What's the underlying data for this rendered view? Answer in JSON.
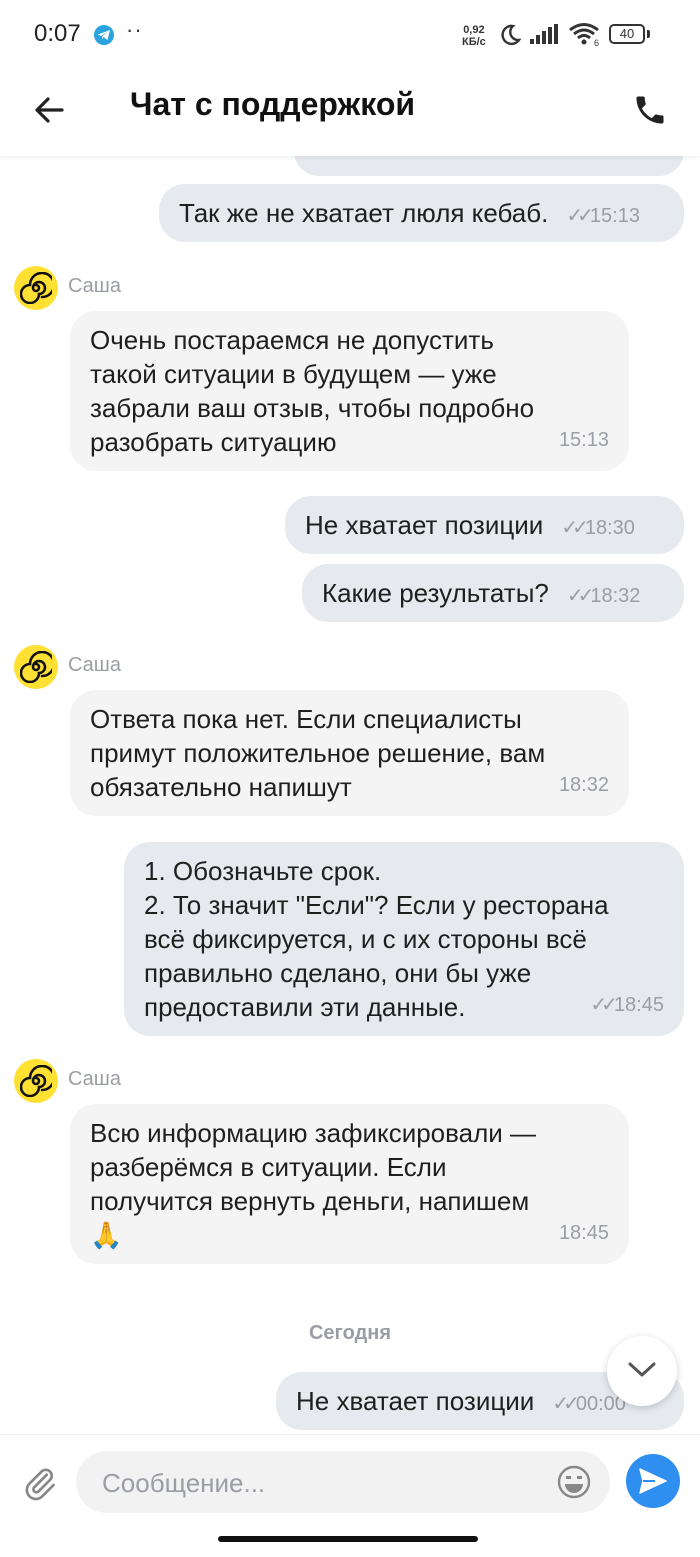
{
  "status": {
    "time": "0:07",
    "net_speed_value": "0,92",
    "net_speed_unit": "КБ/с",
    "battery": "40",
    "icons": [
      "telegram-icon",
      "moon-icon",
      "signal-icon",
      "wifi-icon",
      "battery-icon"
    ]
  },
  "header": {
    "title": "Чат с поддержкой",
    "back_icon": "arrow-left-icon",
    "call_icon": "phone-icon"
  },
  "messages": [
    {
      "id": 1,
      "direction": "out",
      "lines": [
        "Так же не хватает люля кебаб."
      ],
      "time": "15:13",
      "status": "read"
    },
    {
      "id": 2,
      "direction": "in",
      "sender": "Саша",
      "lines": [
        "Очень постараемся не допустить",
        "такой ситуации в будущем — уже",
        "забрали ваш отзыв, чтобы подробно",
        "разобрать ситуацию"
      ],
      "time": "15:13"
    },
    {
      "id": 3,
      "direction": "out",
      "lines": [
        "Не хватает позиции"
      ],
      "time": "18:30",
      "status": "read"
    },
    {
      "id": 4,
      "direction": "out",
      "lines": [
        "Какие результаты?"
      ],
      "time": "18:32",
      "status": "read"
    },
    {
      "id": 5,
      "direction": "in",
      "sender": "Саша",
      "lines": [
        "Ответа пока нет. Если специалисты",
        "примут положительное решение, вам",
        "обязательно напишут"
      ],
      "time": "18:32"
    },
    {
      "id": 6,
      "direction": "out",
      "lines": [
        "1. Обозначьте срок.",
        "2. То значит \"Если\"? Если у ресторана",
        "всё фиксируется, и с их стороны всё",
        "правильно сделано, они бы уже",
        "предоставили эти данные."
      ],
      "time": "18:45",
      "status": "read"
    },
    {
      "id": 7,
      "direction": "in",
      "sender": "Саша",
      "lines": [
        "Всю информацию зафиксировали —",
        "разберёмся в ситуации. Если",
        "получится вернуть деньги, напишем",
        "🙏"
      ],
      "time": "18:45"
    },
    {
      "id": 8,
      "direction": "out",
      "lines": [
        "Не хватает позиции"
      ],
      "time": "00:00",
      "status": "read"
    }
  ],
  "date_separator": "Сегодня",
  "composer": {
    "placeholder": "Сообщение...",
    "value": ""
  }
}
